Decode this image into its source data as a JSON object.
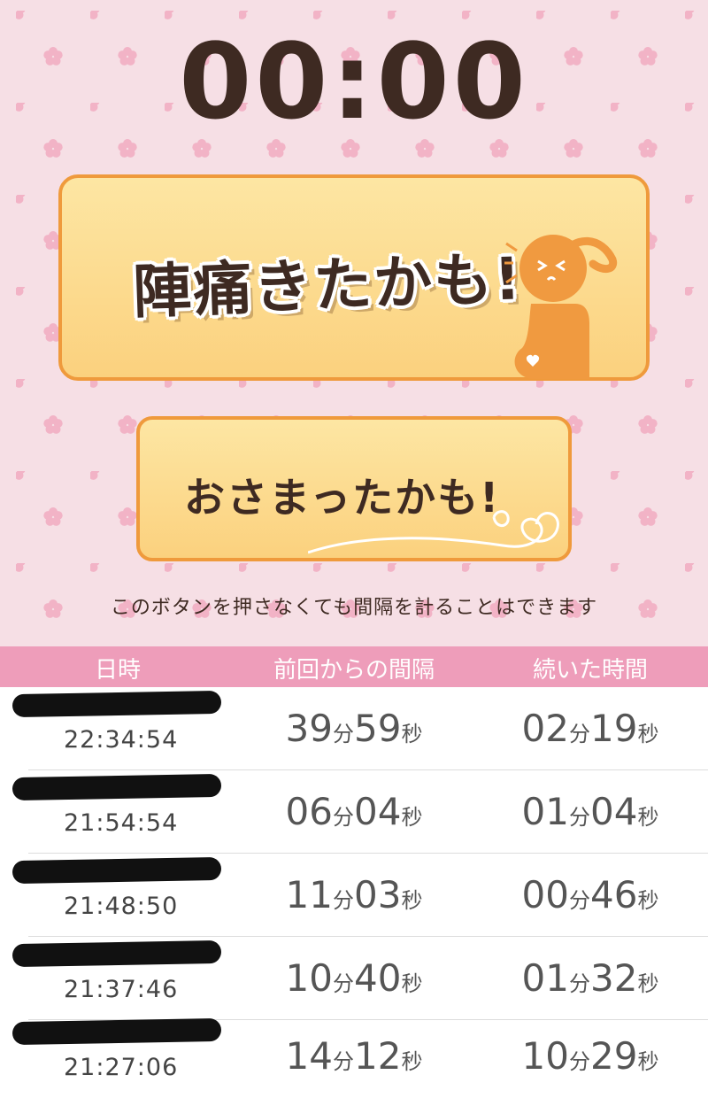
{
  "timer": {
    "display": "00:00"
  },
  "start_button": {
    "label": "陣痛きたかも!"
  },
  "stop_button": {
    "label": "おさまったかも!"
  },
  "note": "このボタンを押さなくても間隔を計ることはできます",
  "table": {
    "headers": [
      "日時",
      "前回からの間隔",
      "続いた時間"
    ],
    "rows": [
      {
        "time": "22:34:54",
        "interval_min": "39",
        "interval_sec": "59",
        "duration_min": "02",
        "duration_sec": "19"
      },
      {
        "time": "21:54:54",
        "interval_min": "06",
        "interval_sec": "04",
        "duration_min": "01",
        "duration_sec": "04"
      },
      {
        "time": "21:48:50",
        "interval_min": "11",
        "interval_sec": "03",
        "duration_min": "00",
        "duration_sec": "46"
      },
      {
        "time": "21:37:46",
        "interval_min": "10",
        "interval_sec": "40",
        "duration_min": "01",
        "duration_sec": "32"
      },
      {
        "time": "21:27:06",
        "interval_min": "14",
        "interval_sec": "12",
        "duration_min": "10",
        "duration_sec": "29"
      }
    ]
  },
  "units": {
    "min": "分",
    "sec": "秒"
  },
  "colors": {
    "background": "#f6dfe5",
    "flower": "#f2b3c6",
    "button_fill": "#fbd17e",
    "button_border": "#ef9a3c",
    "header_bar": "#ee9dba",
    "text_dark": "#3e2a22"
  }
}
